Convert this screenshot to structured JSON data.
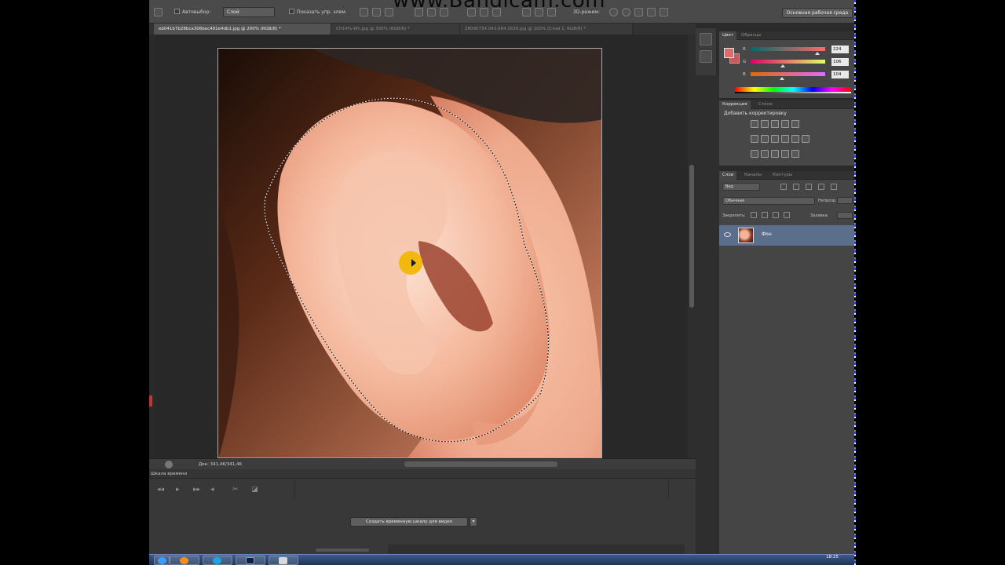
{
  "app": {
    "name": "Adobe Photoshop CS6"
  },
  "watermark": "www.Bandicam.com",
  "options_bar": {
    "autoselect_label": "Автовыбор:",
    "autoselect_value": "Слой",
    "show_controls_label": "Показать упр. элем.",
    "mode_3d_label": "3D-режим:",
    "workspace_button": "Основная рабочая среда"
  },
  "documents": {
    "tabs": [
      {
        "label": "eb041b7b28bca306bec491e4db1.jpg @ 200% (RGB/8) *",
        "active": true
      },
      {
        "label": "CH14%-Wh.jpg @ 300% (RGB/8) *",
        "active": false
      },
      {
        "label": "28090734.043.064.1639.jpg @ 100% (Слой 1, RGB/8) *",
        "active": false
      }
    ]
  },
  "status_bar": {
    "doc_info": "Док: 341,4K/341,4K"
  },
  "timeline": {
    "title": "Шкала времени",
    "create_button": "Создать временную шкалу для видео"
  },
  "color_panel": {
    "tabs": [
      "Цвет",
      "Образцы"
    ],
    "channels": [
      {
        "label": "R",
        "value": "224"
      },
      {
        "label": "G",
        "value": "106"
      },
      {
        "label": "B",
        "value": "104"
      }
    ],
    "foreground": "#e06a68",
    "background": "#c75b5a"
  },
  "adjustments_panel": {
    "tabs": [
      "Коррекция",
      "Стили"
    ],
    "add_label": "Добавить корректировку"
  },
  "layers_panel": {
    "tabs": [
      "Слои",
      "Каналы",
      "Контуры"
    ],
    "filter_label": "Вид",
    "blend_mode": "Обычные",
    "opacity_label": "Непрозр.:",
    "lock_label": "Закрепить:",
    "fill_label": "Заливка:",
    "layers": [
      {
        "name": "Фон",
        "selected": true
      }
    ]
  },
  "taskbar": {
    "time": "18:25"
  }
}
